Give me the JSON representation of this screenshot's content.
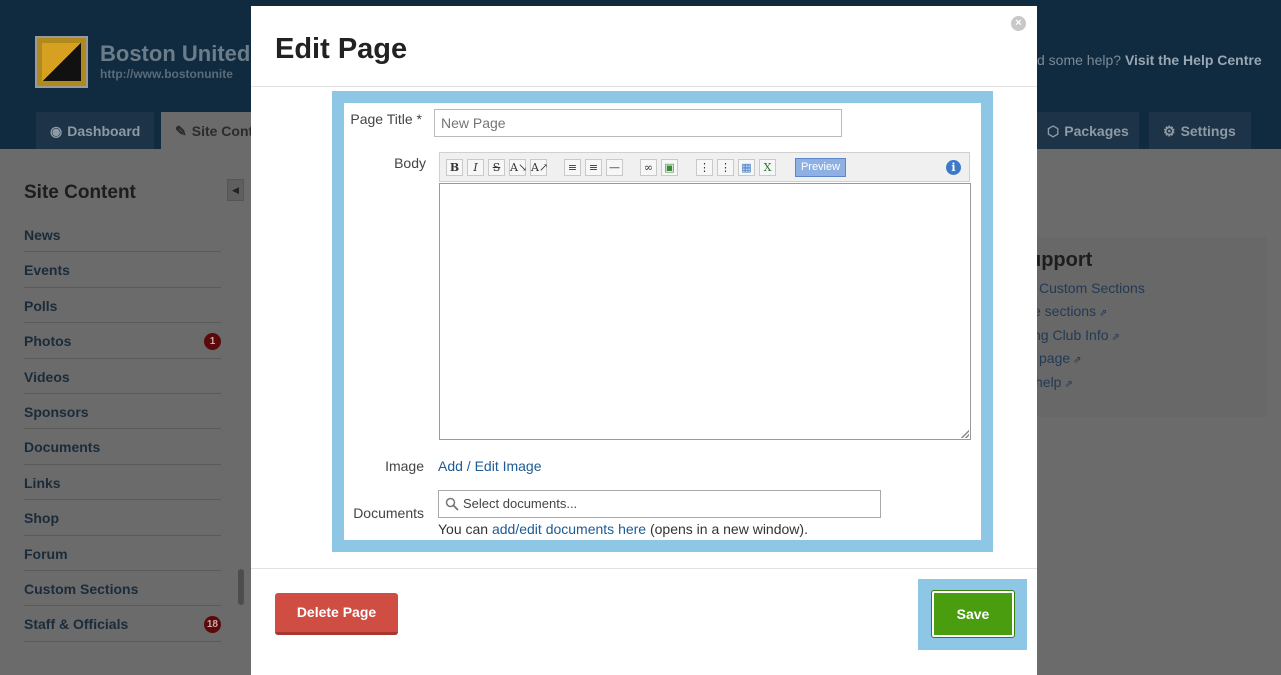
{
  "header": {
    "site_name": "Boston United",
    "site_url": "http://www.bostonunite",
    "help_prefix": "d some help?",
    "help_link": "Visit the Help Centre"
  },
  "nav": {
    "tabs": [
      {
        "label": "Dashboard",
        "icon": "dashboard-icon"
      },
      {
        "label": "Site Cont",
        "icon": "pencil-icon"
      },
      {
        "label": "Packages",
        "icon": "package-icon"
      },
      {
        "label": "Settings",
        "icon": "gear-icon"
      }
    ]
  },
  "sidebar": {
    "title": "Site Content",
    "items": [
      {
        "label": "News",
        "badge": ""
      },
      {
        "label": "Events",
        "badge": ""
      },
      {
        "label": "Polls",
        "badge": ""
      },
      {
        "label": "Photos",
        "badge": "1"
      },
      {
        "label": "Videos",
        "badge": ""
      },
      {
        "label": "Sponsors",
        "badge": ""
      },
      {
        "label": "Documents",
        "badge": ""
      },
      {
        "label": "Links",
        "badge": ""
      },
      {
        "label": "Shop",
        "badge": ""
      },
      {
        "label": "Forum",
        "badge": ""
      },
      {
        "label": "Custom Sections",
        "badge": ""
      },
      {
        "label": "Staff & Officials",
        "badge": "18"
      }
    ]
  },
  "support": {
    "title": "upport",
    "links": [
      "Custom Sections",
      "e sections",
      "ng Club Info",
      "page",
      "help"
    ]
  },
  "modal": {
    "title": "Edit Page",
    "close_label": "×",
    "fields": {
      "page_title_label": "Page Title *",
      "page_title_placeholder": "New Page",
      "body_label": "Body",
      "image_label": "Image",
      "image_link": "Add / Edit Image",
      "documents_label": "Documents",
      "documents_placeholder": "Select documents...",
      "documents_note_prefix": "You can",
      "documents_note_link": "add/edit documents here",
      "documents_note_suffix": "(opens in a new window)."
    },
    "toolbar": {
      "bold": "B",
      "italic": "I",
      "strike": "S",
      "preview": "Preview",
      "info": "i"
    },
    "delete_label": "Delete Page",
    "save_label": "Save"
  },
  "colors": {
    "highlight": "#8ec7e6",
    "save": "#4a9d0e",
    "delete": "#cf4d43",
    "link": "#1d5b93"
  }
}
